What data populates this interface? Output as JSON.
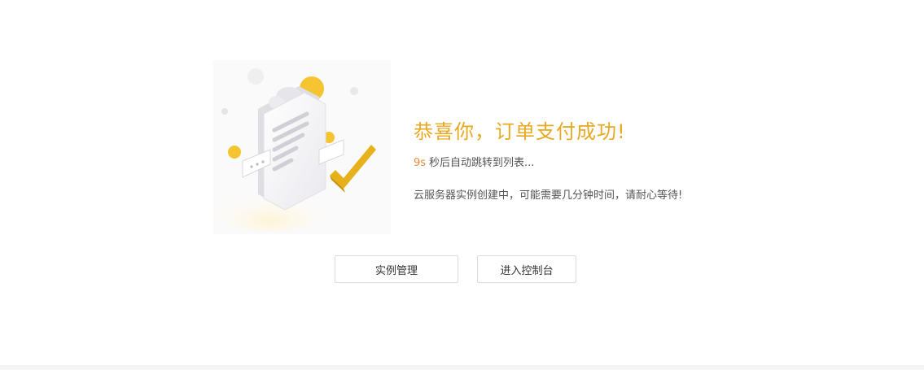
{
  "result": {
    "title": "恭喜你，订单支付成功!",
    "countdown_seconds": "9s",
    "countdown_text": "秒后自动跳转到列表...",
    "note": "云服务器实例创建中，可能需要几分钟时间，请耐心等待!"
  },
  "actions": {
    "instance_manage_label": "实例管理",
    "console_label": "进入控制台"
  },
  "colors": {
    "accent": "#e9a820",
    "countdown": "#f08a3a",
    "text": "#555555"
  },
  "icons": {
    "illustration": "success-document-check-illustration"
  }
}
